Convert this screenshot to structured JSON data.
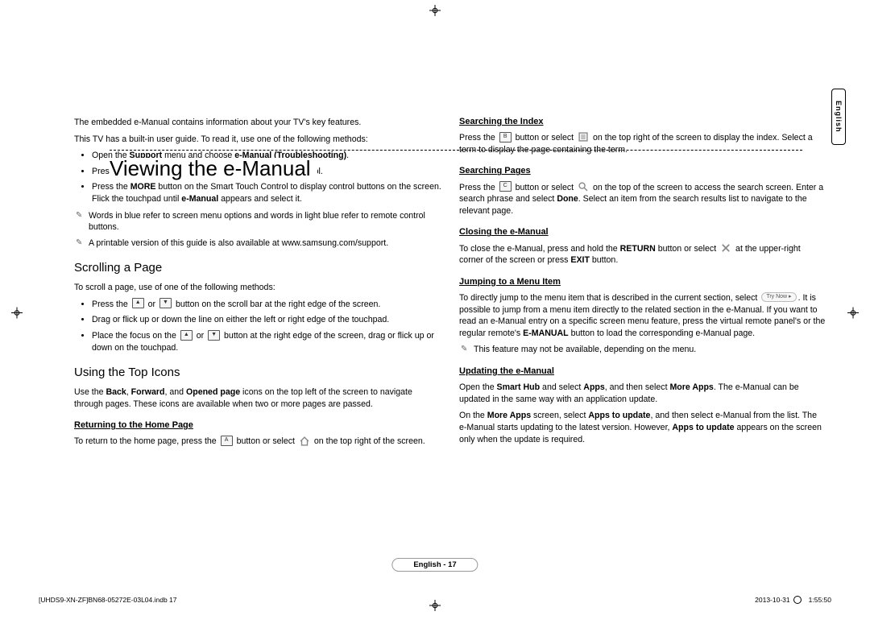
{
  "lang_tab": "English",
  "title": "Viewing the e-Manual",
  "intro1": "The embedded e-Manual contains information about your TV's key features.",
  "intro2": "This TV has a built-in user guide. To read it, use one of the following methods:",
  "open_b1a": "Open the ",
  "open_b1b": "Support",
  "open_b1c": " menu and choose ",
  "open_b1d": "e-Manual (Troubleshooting)",
  "open_b1e": ".",
  "open_b2a": "Press the ",
  "open_b2b": "E-MANUAL",
  "open_b2c": " button on the standard remote control.",
  "open_b3a": "Press the ",
  "open_b3b": "MORE",
  "open_b3c": " button on the Smart Touch Control to display control buttons on the screen. Flick the touchpad until ",
  "open_b3d": "e-Manual",
  "open_b3e": " appears and select it.",
  "note1": "Words in blue refer to screen menu options and words in light blue refer to remote control buttons.",
  "note2": "A printable version of this guide is also available at www.samsung.com/support.",
  "h_scroll": "Scrolling a Page",
  "scroll_p": "To scroll a page, use of one of the following methods:",
  "sc_b1a": "Press the ",
  "sc_b1b": " or ",
  "sc_b1c": " button on the scroll bar at the right edge of the screen.",
  "sc_b2": "Drag or flick up or down the line on either the left or right edge of the touchpad.",
  "sc_b3a": "Place the focus on the ",
  "sc_b3b": " or ",
  "sc_b3c": " button at the right edge of the screen, drag or flick up or down on the touchpad.",
  "h_top": "Using the Top Icons",
  "top_pa": "Use the ",
  "top_back": "Back",
  "top_s1": ", ",
  "top_fwd": "Forward",
  "top_s2": ", and ",
  "top_op": "Opened page",
  "top_pb": " icons on the top left of the screen to navigate through pages. These icons are available when two or more pages are passed.",
  "h_return": "Returning to the Home Page",
  "ret_a": "To return to the home page, press the ",
  "ret_b": " button or select ",
  "ret_c": " on the top right of the screen.",
  "h_index": "Searching the Index",
  "idx_a": "Press the ",
  "idx_b": " button or select ",
  "idx_c": " on the top right of the screen to display the index. Select a term to display the page containing the term.",
  "h_sp": "Searching Pages",
  "sp_a": "Press the ",
  "sp_b": " button or select ",
  "sp_c": " on the top of the screen to access the search screen. Enter a search phrase and select ",
  "sp_done": "Done",
  "sp_d": ". Select an item from the search results list to navigate to the relevant page.",
  "h_close": "Closing the e-Manual",
  "cl_a": "To close the e-Manual, press and hold the ",
  "cl_ret": "RETURN",
  "cl_b": " button or select ",
  "cl_c": " at the upper-right corner of the screen or press ",
  "cl_exit": "EXIT",
  "cl_d": " button.",
  "h_jump": "Jumping to a Menu Item",
  "jmp_a": "To directly jump to the menu item that is described in the current section, select ",
  "jmp_try": "Try Now ▸",
  "jmp_b": ". It is possible to jump from a menu item directly to the related section in the e-Manual. If you want to read an e-Manual entry on a specific screen menu feature, press the virtual remote panel's or the regular remote's ",
  "jmp_eman": "E-MANUAL",
  "jmp_c": " button to load the corresponding e-Manual page.",
  "jmp_note": "This feature may not be available, depending on the menu.",
  "h_upd": "Updating the e-Manual",
  "upd_a": "Open the ",
  "upd_sh": "Smart Hub",
  "upd_b": " and select ",
  "upd_apps": "Apps",
  "upd_c": ", and then select ",
  "upd_ma": "More Apps",
  "upd_d": ". The e-Manual can be updated in the same way with an application update.",
  "upd2_a": "On the ",
  "upd2_ma": "More Apps",
  "upd2_b": " screen, select ",
  "upd2_atu": "Apps to update",
  "upd2_c": ", and then select e-Manual from the list. The e-Manual starts updating to the latest version. However, ",
  "upd2_atu2": "Apps to update",
  "upd2_d": " appears on the screen only when the update is required.",
  "footer": "English - 17",
  "meta_left": "[UHDS9-XN-ZF]BN68-05272E-03L04.indb   17",
  "meta_right": "2013-10-31   ",
  "meta_time": "1:55:50",
  "key_a": "A",
  "key_b": "B",
  "key_c": "C"
}
